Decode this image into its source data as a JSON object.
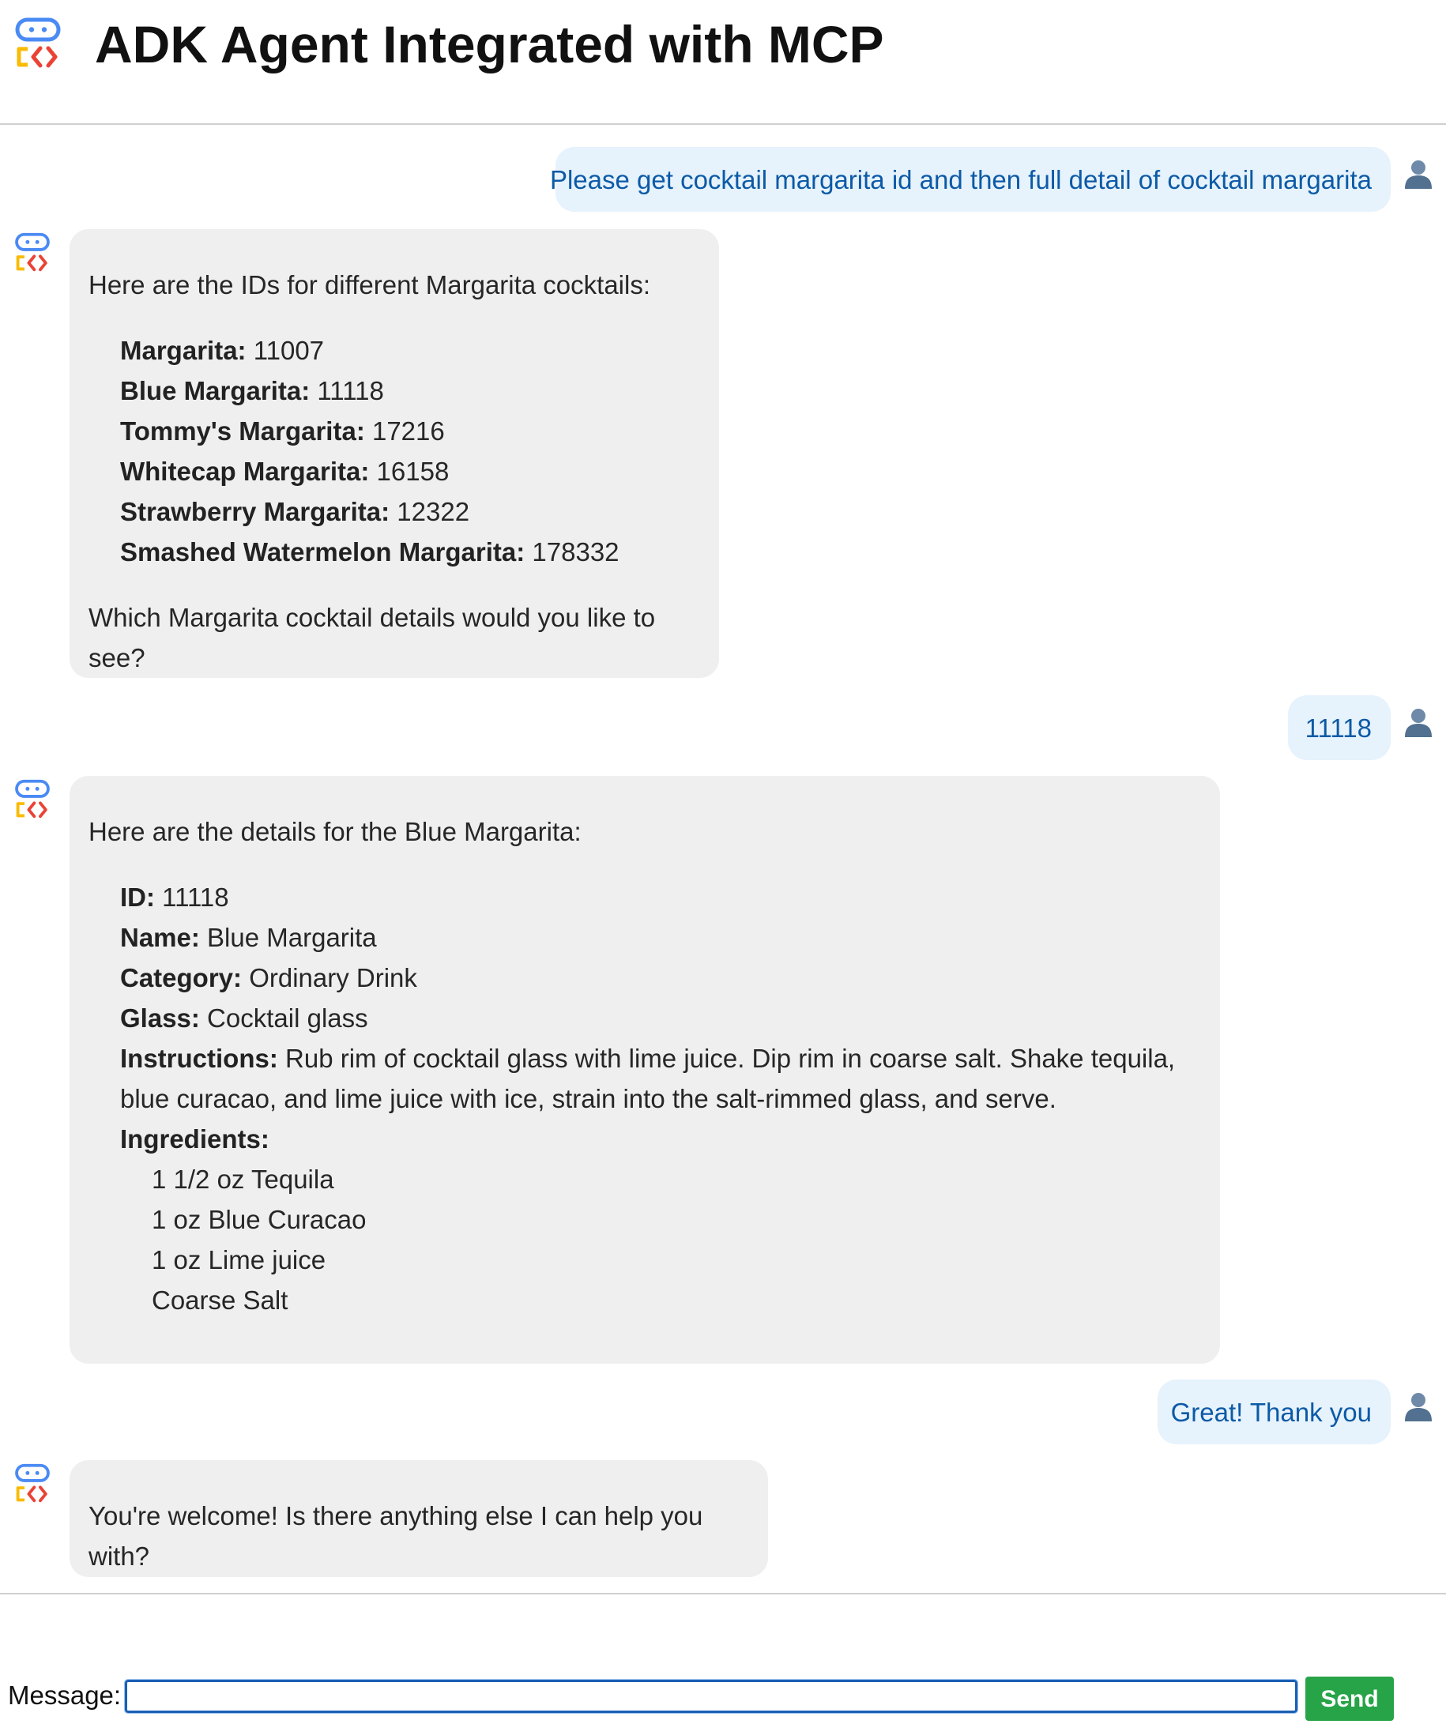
{
  "header": {
    "title": "ADK Agent Integrated with MCP",
    "logo_icon": "adk-robot-logo-icon"
  },
  "colors": {
    "user_bubble_bg": "#e6f2fc",
    "user_text": "#0c5aa6",
    "bot_bubble_bg": "#efefef",
    "send_button": "#27a447",
    "input_border": "#1a5fb4"
  },
  "messages": {
    "m1": {
      "role": "user",
      "text": "Please get cocktail margarita id and then full detail of cocktail margarita",
      "avatar_icon": "user-avatar-icon"
    },
    "m2": {
      "role": "bot",
      "avatar_icon": "adk-robot-logo-icon",
      "intro": "Here are the IDs for different Margarita cocktails:",
      "items": [
        {
          "label": "Margarita:",
          "value": " 11007"
        },
        {
          "label": "Blue Margarita:",
          "value": " 11118"
        },
        {
          "label": "Tommy's Margarita:",
          "value": " 17216"
        },
        {
          "label": "Whitecap Margarita:",
          "value": " 16158"
        },
        {
          "label": "Strawberry Margarita:",
          "value": " 12322"
        },
        {
          "label": "Smashed Watermelon Margarita:",
          "value": " 178332"
        }
      ],
      "outro": "Which Margarita cocktail details would you like to see?"
    },
    "m3": {
      "role": "user",
      "text": "11118",
      "avatar_icon": "user-avatar-icon"
    },
    "m4": {
      "role": "bot",
      "avatar_icon": "adk-robot-logo-icon",
      "intro": "Here are the details for the Blue Margarita:",
      "details": [
        {
          "label": "ID:",
          "value": " 11118"
        },
        {
          "label": "Name:",
          "value": " Blue Margarita"
        },
        {
          "label": "Category:",
          "value": " Ordinary Drink"
        },
        {
          "label": "Glass:",
          "value": " Cocktail glass"
        },
        {
          "label": "Instructions:",
          "value": " Rub rim of cocktail glass with lime juice. Dip rim in coarse salt. Shake tequila, blue curacao, and lime juice with ice, strain into the salt-rimmed glass, and serve."
        }
      ],
      "ingredients_label": "Ingredients:",
      "ingredients": [
        "1 1/2 oz Tequila",
        "1 oz Blue Curacao",
        "1 oz Lime juice",
        "Coarse Salt"
      ]
    },
    "m5": {
      "role": "user",
      "text": "Great! Thank you",
      "avatar_icon": "user-avatar-icon"
    },
    "m6": {
      "role": "bot",
      "avatar_icon": "adk-robot-logo-icon",
      "text": "You're welcome! Is there anything else I can help you with?"
    }
  },
  "composer": {
    "label": "Message:",
    "value": "",
    "placeholder": "",
    "send_label": "Send"
  }
}
